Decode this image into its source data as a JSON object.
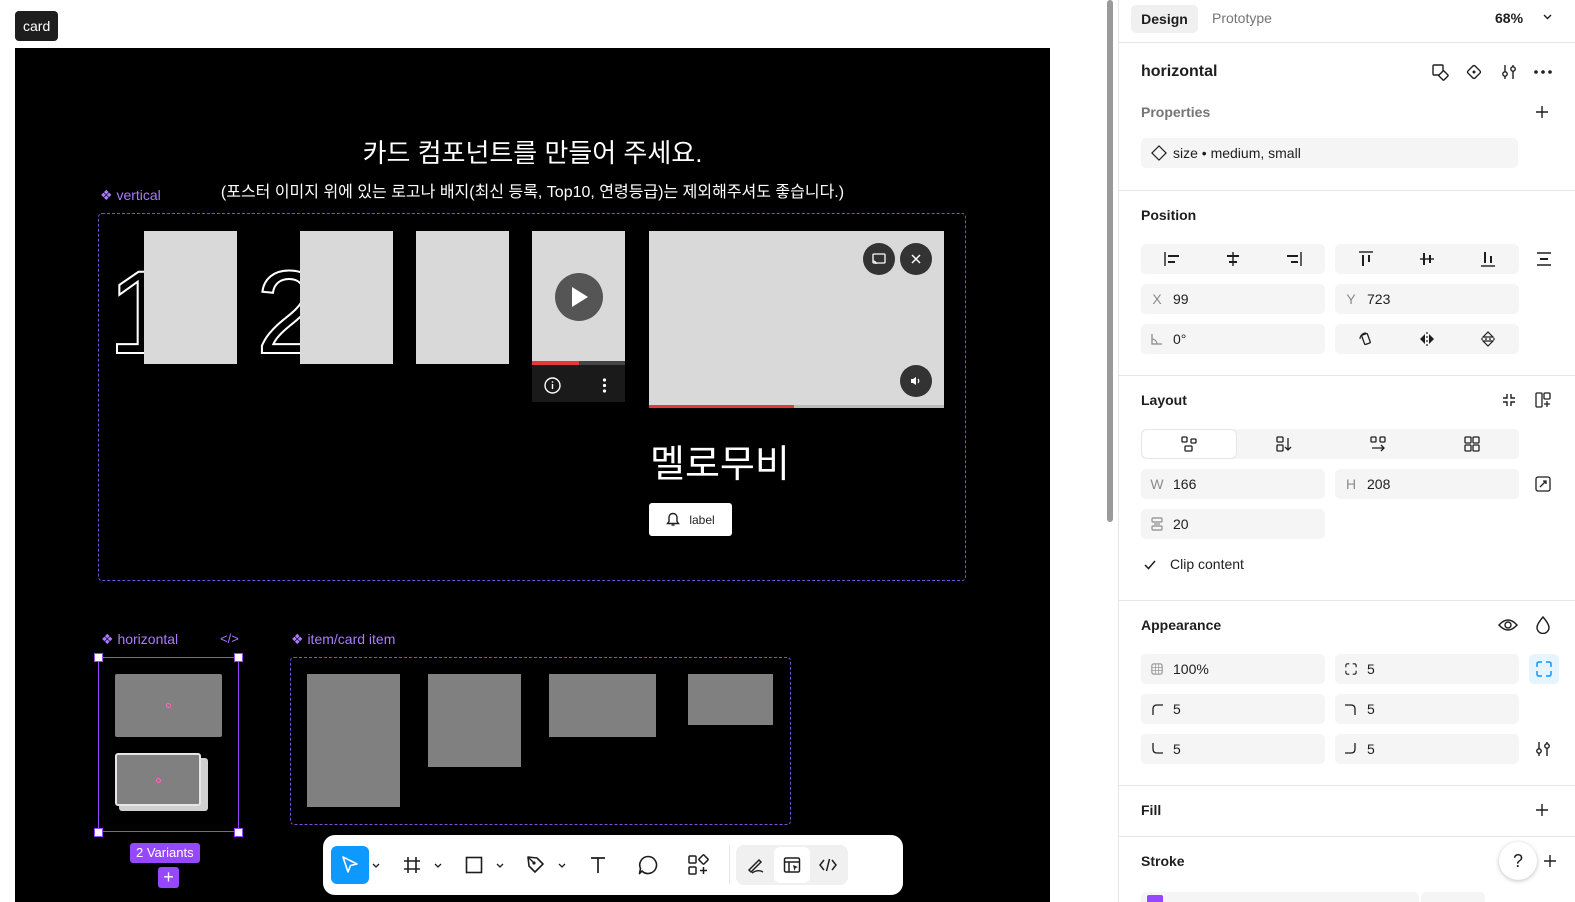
{
  "canvas": {
    "frame_label": "card",
    "heading": "카드 컴포넌트를 만들어 주세요.",
    "subheading": "(포스터 이미지 위에 있는 로고나 배지(최신 등록, Top10, 연령등급)는 제외해주셔도 좋습니다.)",
    "vertical_label": "❖ vertical",
    "rank_numbers": [
      "1",
      "2"
    ],
    "movie_title": "멜로무비",
    "label_button": "label",
    "horizontal_label": "❖ horizontal",
    "code_icon_text": "</>",
    "item_label": "❖ item/card item",
    "variants_badge": "2 Variants",
    "add_variant": "+"
  },
  "toolbar": {
    "tools": [
      {
        "name": "move-tool",
        "icon": "cursor-icon",
        "selected": true
      },
      {
        "name": "frame-tool",
        "icon": "hash-icon"
      },
      {
        "name": "shape-tool",
        "icon": "square-icon"
      },
      {
        "name": "pen-tool",
        "icon": "pen-icon"
      },
      {
        "name": "text-tool",
        "icon": "text-icon"
      },
      {
        "name": "comment-tool",
        "icon": "comment-icon"
      },
      {
        "name": "actions-tool",
        "icon": "components-icon"
      }
    ],
    "modes": [
      "draw-mode-icon",
      "design-mode-icon",
      "dev-mode-icon"
    ]
  },
  "panel": {
    "tabs": {
      "design": "Design",
      "prototype": "Prototype"
    },
    "zoom": "68%",
    "layer_name": "horizontal",
    "properties": {
      "title": "Properties",
      "item": "size • medium, small"
    },
    "position": {
      "title": "Position",
      "x_label": "X",
      "x": "99",
      "y_label": "Y",
      "y": "723",
      "rotation": "0°"
    },
    "layout": {
      "title": "Layout",
      "w_label": "W",
      "w": "166",
      "h_label": "H",
      "h": "208",
      "gap": "20",
      "clip": "Clip content"
    },
    "appearance": {
      "title": "Appearance",
      "opacity": "100%",
      "radius": "5",
      "tl": "5",
      "tr": "5",
      "bl": "5",
      "br": "5"
    },
    "fill": {
      "title": "Fill"
    },
    "stroke": {
      "title": "Stroke"
    },
    "help": "?"
  },
  "colors": {
    "accent": "#0d99ff",
    "component_purple": "#9747ff",
    "progress_red": "#e53935",
    "canvas_black": "#000000"
  }
}
